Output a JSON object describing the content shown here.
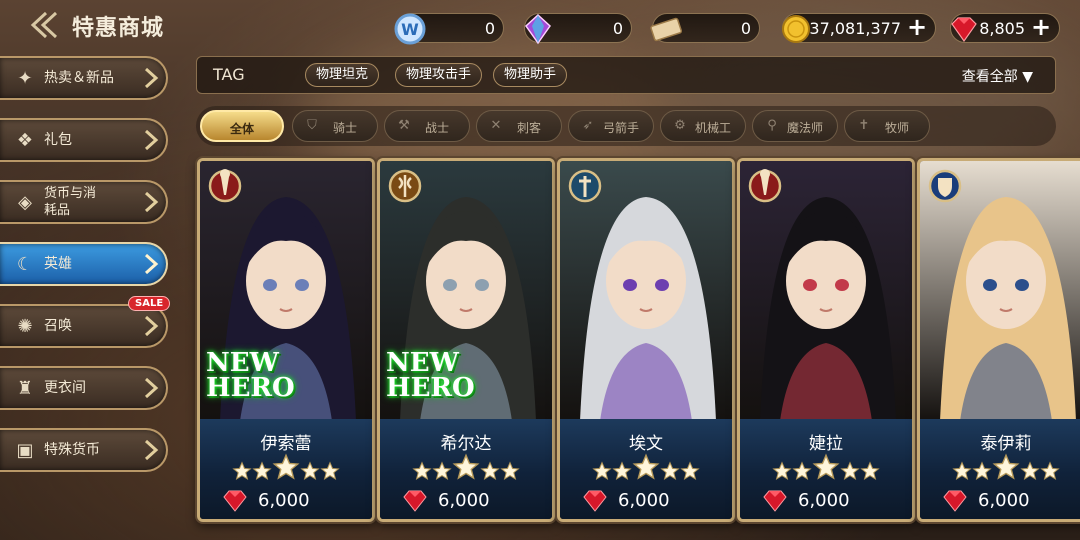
{
  "header": {
    "title": "特惠商城"
  },
  "currencies": [
    {
      "icon": "w-token-icon",
      "value": "0",
      "plus": false
    },
    {
      "icon": "crystal-icon",
      "value": "0",
      "plus": false
    },
    {
      "icon": "ticket-icon",
      "value": "0",
      "plus": false
    },
    {
      "icon": "gold-coin-icon",
      "value": "37,081,377",
      "plus": true
    },
    {
      "icon": "ruby-icon",
      "value": "8,805",
      "plus": true
    }
  ],
  "nav": [
    {
      "label": "热卖＆新品",
      "icon": "hot-new-icon",
      "active": false
    },
    {
      "label": "礼包",
      "icon": "gift-pack-icon",
      "active": false
    },
    {
      "label": "货币与消耗品",
      "icon": "currency-icon",
      "active": false
    },
    {
      "label": "英雄",
      "icon": "hero-icon",
      "active": true
    },
    {
      "label": "召唤",
      "icon": "summon-icon",
      "active": false,
      "badge": "SALE"
    },
    {
      "label": "更衣间",
      "icon": "wardrobe-icon",
      "active": false
    },
    {
      "label": "特殊货币",
      "icon": "special-currency-icon",
      "active": false
    }
  ],
  "tags": {
    "title": "TAG",
    "chips": [
      "物理坦克",
      "物理攻击手",
      "物理助手"
    ],
    "view_all": "查看全部 ▼"
  },
  "filters": [
    {
      "label": "全体",
      "icon": "",
      "active": true
    },
    {
      "label": "骑士",
      "icon": "shield-icon"
    },
    {
      "label": "战士",
      "icon": "axe-icon"
    },
    {
      "label": "刺客",
      "icon": "dagger-icon"
    },
    {
      "label": "弓箭手",
      "icon": "bow-icon"
    },
    {
      "label": "机械工",
      "icon": "wrench-icon"
    },
    {
      "label": "魔法师",
      "icon": "staff-icon"
    },
    {
      "label": "牧师",
      "icon": "cross-icon"
    }
  ],
  "heroes": [
    {
      "name": "伊索蕾",
      "role": "wizard-role-icon",
      "new": true,
      "new_text": [
        "NEW",
        "HERO"
      ],
      "stars": 5,
      "price": "6,000",
      "colors": {
        "bg": "#2a2530",
        "hair": "#1c1830",
        "accent": "#6b7fb8"
      }
    },
    {
      "name": "希尔达",
      "role": "warrior-role-icon",
      "new": true,
      "new_text": [
        "NEW",
        "HERO"
      ],
      "stars": 5,
      "price": "6,000",
      "colors": {
        "bg": "#2b3a3e",
        "hair": "#2c2e2b",
        "accent": "#8da0b0"
      }
    },
    {
      "name": "埃文",
      "role": "priest-role-icon",
      "new": false,
      "stars": 5,
      "price": "6,000",
      "colors": {
        "bg": "#3a4a4c",
        "hair": "#d6d8dc",
        "accent": "#6d3fb0"
      }
    },
    {
      "name": "婕拉",
      "role": "wizard-role-icon",
      "new": false,
      "stars": 5,
      "price": "6,000",
      "colors": {
        "bg": "#2c2436",
        "hair": "#141216",
        "accent": "#c23a4a"
      }
    },
    {
      "name": "泰伊莉",
      "role": "knight-role-icon",
      "new": false,
      "stars": 5,
      "price": "6,000",
      "colors": {
        "bg": "#e6ddd0",
        "hair": "#e8c48a",
        "accent": "#2c4f8c"
      }
    }
  ],
  "theme": {
    "gold": "#c8ab76",
    "active_blue": "#2a7fd0",
    "ruby": "#d7182a"
  }
}
